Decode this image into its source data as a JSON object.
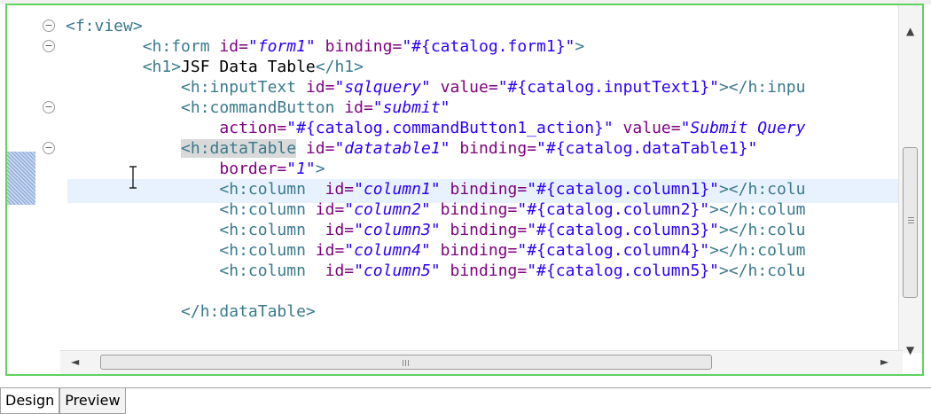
{
  "editor": {
    "lines": [
      {
        "fold": true,
        "parts": [
          {
            "t": "<f:view>",
            "c": "tag"
          }
        ]
      },
      {
        "fold": true,
        "parts": [
          {
            "t": "        <h:form ",
            "c": "tag"
          },
          {
            "t": "id=",
            "c": "attr"
          },
          {
            "t": "\"form1\"",
            "c": "val"
          },
          {
            "t": " binding=",
            "c": "attr"
          },
          {
            "t": "\"#{catalog.form1}\"",
            "c": "str"
          },
          {
            "t": ">",
            "c": "tag"
          }
        ]
      },
      {
        "fold": false,
        "parts": [
          {
            "t": "        <h1>",
            "c": "tag"
          },
          {
            "t": "JSF Data Table",
            "c": "plain"
          },
          {
            "t": "</h1>",
            "c": "tag"
          }
        ]
      },
      {
        "fold": false,
        "parts": [
          {
            "t": "            <h:inputText ",
            "c": "tag"
          },
          {
            "t": "id=",
            "c": "attr"
          },
          {
            "t": "\"sqlquery\"",
            "c": "val"
          },
          {
            "t": " value=",
            "c": "attr"
          },
          {
            "t": "\"#{catalog.inputText1}\"",
            "c": "str"
          },
          {
            "t": "></h:inpu",
            "c": "tag"
          }
        ]
      },
      {
        "fold": true,
        "parts": [
          {
            "t": "            <h:commandButton ",
            "c": "tag"
          },
          {
            "t": "id=",
            "c": "attr"
          },
          {
            "t": "\"submit\"",
            "c": "val"
          }
        ]
      },
      {
        "fold": false,
        "parts": [
          {
            "t": "                action=",
            "c": "attr"
          },
          {
            "t": "\"#{catalog.commandButton1_action}\"",
            "c": "str"
          },
          {
            "t": " value=",
            "c": "attr"
          },
          {
            "t": "\"Submit Query",
            "c": "val"
          }
        ]
      },
      {
        "fold": true,
        "parts": [
          {
            "t": "            ",
            "c": "plain"
          },
          {
            "t": "<h:dataTable",
            "c": "tag sel"
          },
          {
            "t": " id=",
            "c": "attr"
          },
          {
            "t": "\"datatable1\"",
            "c": "val"
          },
          {
            "t": " binding=",
            "c": "attr"
          },
          {
            "t": "\"#{catalog.dataTable1}\"",
            "c": "str"
          }
        ]
      },
      {
        "fold": false,
        "parts": [
          {
            "t": "                border=",
            "c": "attr"
          },
          {
            "t": "\"1\"",
            "c": "val"
          },
          {
            "t": ">",
            "c": "tag"
          }
        ]
      },
      {
        "fold": false,
        "parts": [
          {
            "t": "                <h:column  ",
            "c": "tag"
          },
          {
            "t": "id=",
            "c": "attr"
          },
          {
            "t": "\"column1\"",
            "c": "val"
          },
          {
            "t": " binding=",
            "c": "attr"
          },
          {
            "t": "\"#{catalog.column1}\"",
            "c": "str"
          },
          {
            "t": "></h:colu",
            "c": "tag"
          }
        ]
      },
      {
        "fold": false,
        "parts": [
          {
            "t": "                <h:column ",
            "c": "tag"
          },
          {
            "t": "id=",
            "c": "attr"
          },
          {
            "t": "\"column2\"",
            "c": "val"
          },
          {
            "t": " binding=",
            "c": "attr"
          },
          {
            "t": "\"#{catalog.column2}\"",
            "c": "str"
          },
          {
            "t": "></h:colum",
            "c": "tag"
          }
        ]
      },
      {
        "fold": false,
        "parts": [
          {
            "t": "                <h:column  ",
            "c": "tag"
          },
          {
            "t": "id=",
            "c": "attr"
          },
          {
            "t": "\"column3\"",
            "c": "val"
          },
          {
            "t": " binding=",
            "c": "attr"
          },
          {
            "t": "\"#{catalog.column3}\"",
            "c": "str"
          },
          {
            "t": "></h:colu",
            "c": "tag"
          }
        ]
      },
      {
        "fold": false,
        "parts": [
          {
            "t": "                <h:column ",
            "c": "tag"
          },
          {
            "t": "id=",
            "c": "attr"
          },
          {
            "t": "\"column4\"",
            "c": "val"
          },
          {
            "t": " binding=",
            "c": "attr"
          },
          {
            "t": "\"#{catalog.column4}\"",
            "c": "str"
          },
          {
            "t": "></h:colum",
            "c": "tag"
          }
        ]
      },
      {
        "fold": false,
        "parts": [
          {
            "t": "                <h:column  ",
            "c": "tag"
          },
          {
            "t": "id=",
            "c": "attr"
          },
          {
            "t": "\"column5\"",
            "c": "val"
          },
          {
            "t": " binding=",
            "c": "attr"
          },
          {
            "t": "\"#{catalog.column5}\"",
            "c": "str"
          },
          {
            "t": "></h:colu",
            "c": "tag"
          }
        ]
      },
      {
        "fold": false,
        "parts": [
          {
            "t": "",
            "c": "plain"
          }
        ]
      },
      {
        "fold": false,
        "parts": [
          {
            "t": "            </h:dataTable>",
            "c": "tag"
          }
        ]
      }
    ]
  },
  "scroll": {
    "hgrip": "III",
    "vgrip": "≡",
    "up": "▲",
    "down": "▼",
    "left": "◄",
    "right": "►"
  },
  "tabs": [
    {
      "label": "Design",
      "active": true
    },
    {
      "label": "Preview",
      "active": false
    }
  ],
  "colors": {
    "border": "#5fd35f",
    "tag": "#3a7a8c",
    "attr": "#7f007f",
    "value": "#2a00ff"
  }
}
